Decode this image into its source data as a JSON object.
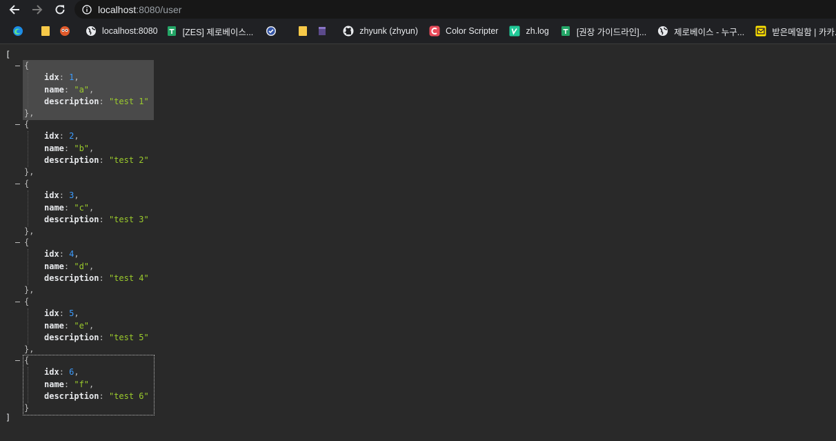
{
  "browser": {
    "url_host": "localhost",
    "url_path": ":8080/user"
  },
  "bookmarks": [
    {
      "icon": "edge-icon",
      "label": ""
    },
    {
      "icon": "folder-icon",
      "label": ""
    },
    {
      "icon": "owl-icon",
      "label": ""
    },
    {
      "icon": "globe-icon",
      "label": "localhost:8080"
    },
    {
      "icon": "sheets-icon",
      "label": "[ZES] 제로베이스..."
    },
    {
      "icon": "checkmark-icon",
      "label": ""
    },
    {
      "icon": "folder-icon",
      "label": ""
    },
    {
      "icon": "clapperboard-icon",
      "label": ""
    },
    {
      "icon": "github-icon",
      "label": "zhyunk (zhyun)"
    },
    {
      "icon": "color-scripter-icon",
      "label": "Color Scripter"
    },
    {
      "icon": "velog-icon",
      "label": "zh.log"
    },
    {
      "icon": "sheets-icon",
      "label": "[권장 가이드라인]..."
    },
    {
      "icon": "globe-icon",
      "label": "제로베이스 - 누구..."
    },
    {
      "icon": "kakao-mail-icon",
      "label": "받은메일함 | 카카..."
    }
  ],
  "json": {
    "open_bracket": "[",
    "close_bracket": "]",
    "items": [
      {
        "idx": "1",
        "name": "\"a\"",
        "description": "\"test 1\""
      },
      {
        "idx": "2",
        "name": "\"b\"",
        "description": "\"test 2\""
      },
      {
        "idx": "3",
        "name": "\"c\"",
        "description": "\"test 3\""
      },
      {
        "idx": "4",
        "name": "\"d\"",
        "description": "\"test 4\""
      },
      {
        "idx": "5",
        "name": "\"e\"",
        "description": "\"test 5\""
      },
      {
        "idx": "6",
        "name": "\"f\"",
        "description": "\"test 6\""
      }
    ],
    "keys": {
      "idx": "idx",
      "name": "name",
      "description": "description"
    }
  }
}
